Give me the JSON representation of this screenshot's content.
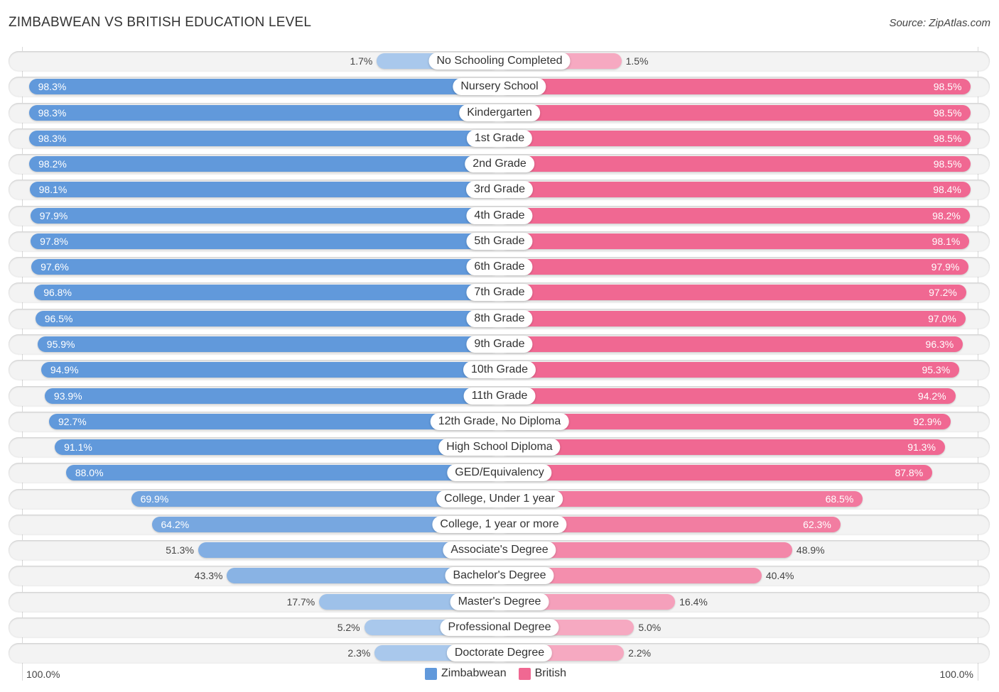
{
  "header": {
    "title": "ZIMBABWEAN VS BRITISH EDUCATION LEVEL",
    "source": "Source: ZipAtlas.com"
  },
  "colors": {
    "zimbabwean": "#6199db",
    "zimbabwean_light": "#a9c8ec",
    "british": "#f06892",
    "british_light": "#f6a9c1"
  },
  "chart_data": {
    "type": "bar",
    "orientation": "horizontal-diverging",
    "title": "ZIMBABWEAN VS BRITISH EDUCATION LEVEL",
    "categories": [
      "No Schooling Completed",
      "Nursery School",
      "Kindergarten",
      "1st Grade",
      "2nd Grade",
      "3rd Grade",
      "4th Grade",
      "5th Grade",
      "6th Grade",
      "7th Grade",
      "8th Grade",
      "9th Grade",
      "10th Grade",
      "11th Grade",
      "12th Grade, No Diploma",
      "High School Diploma",
      "GED/Equivalency",
      "College, Under 1 year",
      "College, 1 year or more",
      "Associate's Degree",
      "Bachelor's Degree",
      "Master's Degree",
      "Professional Degree",
      "Doctorate Degree"
    ],
    "series": [
      {
        "name": "Zimbabwean",
        "side": "left",
        "values": [
          1.7,
          98.3,
          98.3,
          98.3,
          98.2,
          98.1,
          97.9,
          97.8,
          97.6,
          96.8,
          96.5,
          95.9,
          94.9,
          93.9,
          92.7,
          91.1,
          88.0,
          69.9,
          64.2,
          51.3,
          43.3,
          17.7,
          5.2,
          2.3
        ]
      },
      {
        "name": "British",
        "side": "right",
        "values": [
          1.5,
          98.5,
          98.5,
          98.5,
          98.5,
          98.4,
          98.2,
          98.1,
          97.9,
          97.2,
          97.0,
          96.3,
          95.3,
          94.2,
          92.9,
          91.3,
          87.8,
          68.5,
          62.3,
          48.9,
          40.4,
          16.4,
          5.0,
          2.2
        ]
      }
    ],
    "xlim": [
      0,
      100
    ],
    "unit": "%",
    "axis_labels": {
      "left": "100.0%",
      "right": "100.0%"
    },
    "legend": {
      "position": "bottom-center",
      "entries": [
        "Zimbabwean",
        "British"
      ]
    }
  }
}
